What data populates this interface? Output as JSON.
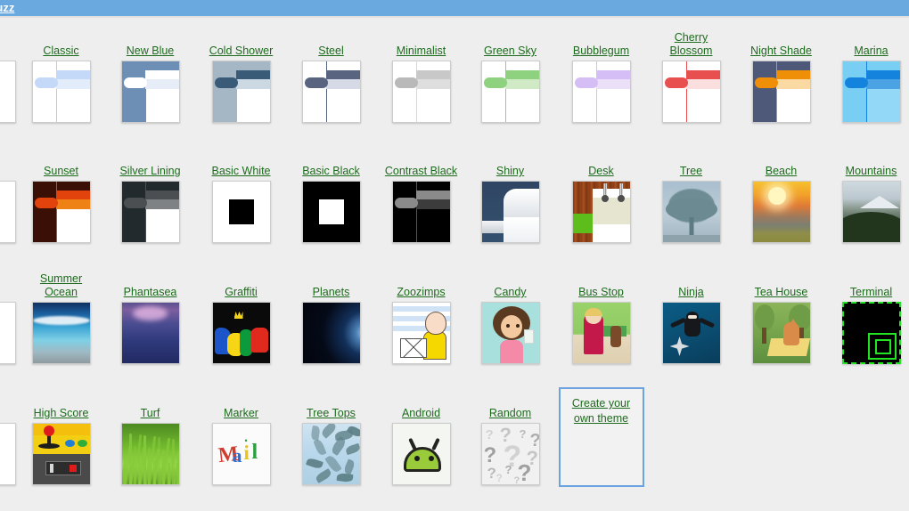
{
  "topbar": {
    "link_label": "Buzz",
    "background": "#6aa9e0",
    "link_color": "#ffffff"
  },
  "page": {
    "background": "#eeeeee",
    "link_color": "#1d6b1d",
    "columns": 10,
    "rows": 4
  },
  "themes": [
    {
      "name": "Classic",
      "style": "chrome",
      "banner": "#ffffff",
      "side": "#ffffff",
      "bar1": "#c3d9f7",
      "bar2": "#e2ecfb",
      "pill": "#c3d9f7",
      "divider": "#b8cbe8",
      "body": "#ffffff"
    },
    {
      "name": "New Blue",
      "style": "chrome",
      "banner": "#6e8fb5",
      "side": "#6e8fb5",
      "bar1": "#ffffff",
      "bar2": "#e7edf6",
      "pill": "#ffffff",
      "divider": "#6e8fb5",
      "body": "#ffffff"
    },
    {
      "name": "Cold Shower",
      "style": "chrome",
      "banner": "#a5b6c4",
      "side": "#a5b6c4",
      "bar1": "#395b78",
      "bar2": "#ccd9e3",
      "pill": "#395b78",
      "divider": "#a5b6c4",
      "body": "#ffffff"
    },
    {
      "name": "Steel",
      "style": "chrome",
      "banner": "#ffffff",
      "side": "#ffffff",
      "bar1": "#596480",
      "bar2": "#d6dae6",
      "pill": "#596480",
      "divider": "#596480",
      "body": "#ffffff"
    },
    {
      "name": "Minimalist",
      "style": "chrome",
      "banner": "#ffffff",
      "side": "#ffffff",
      "bar1": "#c8c8c8",
      "bar2": "#dedede",
      "pill": "#b9b9b9",
      "divider": "#d8d8d8",
      "body": "#ffffff"
    },
    {
      "name": "Green Sky",
      "style": "chrome",
      "banner": "#ffffff",
      "side": "#ffffff",
      "bar1": "#8ed17f",
      "bar2": "#cfeac5",
      "pill": "#8ed17f",
      "divider": "#8ed17f",
      "body": "#ffffff"
    },
    {
      "name": "Bubblegum",
      "style": "chrome",
      "banner": "#ffffff",
      "side": "#ffffff",
      "bar1": "#d5bdf5",
      "bar2": "#ece0f8",
      "pill": "#d5bdf5",
      "divider": "#d5bdf5",
      "body": "#ffffff"
    },
    {
      "name": "Cherry Blossom",
      "style": "chrome",
      "banner": "#ffffff",
      "side": "#ffffff",
      "bar1": "#e8504f",
      "bar2": "#fbdede",
      "pill": "#e8504f",
      "divider": "#e8504f",
      "body": "#ffffff"
    },
    {
      "name": "Night Shade",
      "style": "chrome",
      "banner": "#4e5878",
      "side": "#4e5878",
      "bar1": "#ef8f07",
      "bar2": "#fbd9a2",
      "pill": "#ef8f07",
      "divider": "#ef8f07",
      "body": "#ffffff"
    },
    {
      "name": "Marina",
      "style": "chrome",
      "banner": "#79cef3",
      "side": "#79cef3",
      "bar1": "#1383dd",
      "bar2": "#4ba3e3",
      "pill": "#1383dd",
      "divider": "#1383dd",
      "body": "#93d8f6"
    },
    {
      "name": "Sunset",
      "style": "chrome",
      "banner": "#3a0f06",
      "side": "#3a0f06",
      "bar1": "#e2430c",
      "bar2": "#ef8214",
      "pill": "#e2430c",
      "divider": "#e2430c",
      "body": "#ffffff"
    },
    {
      "name": "Silver Lining",
      "style": "chrome",
      "banner": "#232a2e",
      "side": "#232a2e",
      "bar1": "#4b4f51",
      "bar2": "#7e8284",
      "pill": "#4b4f51",
      "divider": "#4b4f51",
      "body": "#ffffff"
    },
    {
      "name": "Basic White",
      "style": "square",
      "bg": "#ffffff",
      "square": "#000000"
    },
    {
      "name": "Basic Black",
      "style": "square",
      "bg": "#000000",
      "square": "#ffffff"
    },
    {
      "name": "Contrast Black",
      "style": "chrome",
      "banner": "#000000",
      "side": "#000000",
      "bar1": "#8a8a8a",
      "bar2": "#3c3c3c",
      "pill": "#8a8a8a",
      "divider": "#555555",
      "body": "#000000"
    },
    {
      "name": "Shiny",
      "style": "shiny"
    },
    {
      "name": "Desk",
      "style": "desk"
    },
    {
      "name": "Tree",
      "style": "tree"
    },
    {
      "name": "Beach",
      "style": "beach"
    },
    {
      "name": "Mountains",
      "style": "mountains"
    },
    {
      "name": "Summer Ocean",
      "style": "summer-ocean"
    },
    {
      "name": "Phantasea",
      "style": "phantasea"
    },
    {
      "name": "Graffiti",
      "style": "graffiti"
    },
    {
      "name": "Planets",
      "style": "planets"
    },
    {
      "name": "Zoozimps",
      "style": "zoozimps"
    },
    {
      "name": "Candy",
      "style": "candy"
    },
    {
      "name": "Bus Stop",
      "style": "bus-stop"
    },
    {
      "name": "Ninja",
      "style": "ninja"
    },
    {
      "name": "Tea House",
      "style": "tea-house"
    },
    {
      "name": "Terminal",
      "style": "terminal",
      "accent": "#22e422"
    },
    {
      "name": "High Score",
      "style": "high-score"
    },
    {
      "name": "Turf",
      "style": "turf"
    },
    {
      "name": "Marker",
      "style": "marker",
      "word": "ail"
    },
    {
      "name": "Tree Tops",
      "style": "tree-tops"
    },
    {
      "name": "Android",
      "style": "android"
    },
    {
      "name": "Random",
      "style": "random",
      "glyph": "?"
    }
  ],
  "create_own": {
    "label": "Create your own theme",
    "border_color": "#6ba3e0"
  }
}
